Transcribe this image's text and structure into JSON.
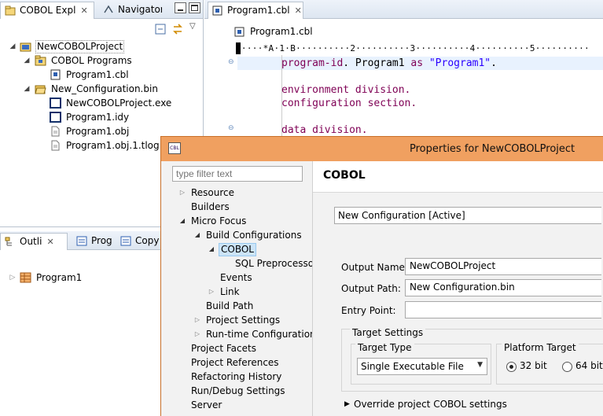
{
  "explorer": {
    "tabs": [
      {
        "label": "COBOL Expl",
        "close": "✕"
      },
      {
        "label": "Navigator",
        "close": ""
      }
    ],
    "tree": [
      {
        "label": "NewCOBOLProject",
        "arrow": "◢"
      },
      {
        "label": "COBOL Programs",
        "arrow": "◢"
      },
      {
        "label": "Program1.cbl",
        "arrow": ""
      },
      {
        "label": "New_Configuration.bin",
        "arrow": "◢"
      },
      {
        "label": "NewCOBOLProject.exe",
        "arrow": ""
      },
      {
        "label": "Program1.idy",
        "arrow": ""
      },
      {
        "label": "Program1.obj",
        "arrow": ""
      },
      {
        "label": "Program1.obj.1.tlog",
        "arrow": ""
      }
    ]
  },
  "editor": {
    "tab": {
      "label": "Program1.cbl",
      "close": "✕"
    },
    "breadcrumb": "Program1.cbl",
    "ruler": "·····*A·1·B··········2··········3··········4··········5··········",
    "lines": {
      "l1_kw": "program-id",
      "l1_mid": ". Program1 ",
      "l1_as": "as",
      "l1_str": "\"Program1\"",
      "l1_end": ".",
      "l2": "environment division.",
      "l3": "configuration section.",
      "l4": "data division."
    }
  },
  "outline": {
    "tabs": [
      {
        "label": "Outli",
        "close": "✕"
      },
      {
        "label": "Prog",
        "close": ""
      },
      {
        "label": "Copy",
        "close": ""
      }
    ],
    "tree": [
      {
        "label": "Program1",
        "arrow": "▷"
      }
    ]
  },
  "dialog": {
    "title": "Properties for NewCOBOLProject",
    "app_icon": "CBL",
    "filter_placeholder": "type filter text",
    "nav": [
      {
        "label": "Resource",
        "arrow": "▷"
      },
      {
        "label": "Builders",
        "arrow": ""
      },
      {
        "label": "Micro Focus",
        "arrow": "◢"
      },
      {
        "label": "Build Configurations",
        "arrow": "◢"
      },
      {
        "label": "COBOL",
        "arrow": "◢"
      },
      {
        "label": "SQL Preprocesso",
        "arrow": ""
      },
      {
        "label": "Events",
        "arrow": ""
      },
      {
        "label": "Link",
        "arrow": "▷"
      },
      {
        "label": "Build Path",
        "arrow": ""
      },
      {
        "label": "Project Settings",
        "arrow": "▷"
      },
      {
        "label": "Run-time Configuration",
        "arrow": "▷"
      },
      {
        "label": "Project Facets",
        "arrow": ""
      },
      {
        "label": "Project References",
        "arrow": ""
      },
      {
        "label": "Refactoring History",
        "arrow": ""
      },
      {
        "label": "Run/Debug Settings",
        "arrow": ""
      },
      {
        "label": "Server",
        "arrow": ""
      }
    ],
    "page_title": "COBOL",
    "configuration": "New Configuration  [Active]",
    "output_name_label": "Output Name:",
    "output_name_value": "NewCOBOLProject",
    "output_path_label": "Output Path:",
    "output_path_value": "New Configuration.bin",
    "entry_point_label": "Entry Point:",
    "entry_point_value": "",
    "target_settings_label": "Target Settings",
    "target_type_label": "Target Type",
    "target_type_value": "Single Executable File",
    "platform_target_label": "Platform Target",
    "radio_32": "32 bit",
    "radio_64": "64 bit",
    "override_label": "Override project COBOL settings"
  }
}
